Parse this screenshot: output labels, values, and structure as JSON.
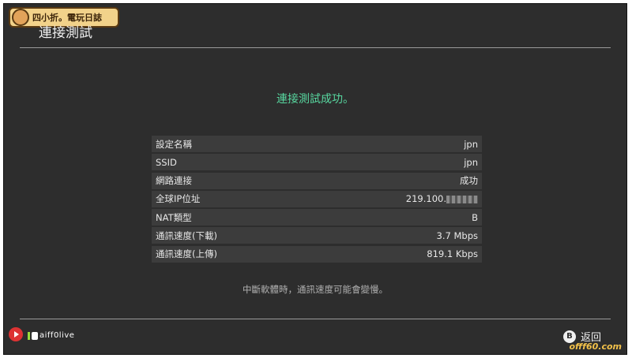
{
  "header": {
    "logo_text": "四小折。電玩日誌",
    "title": "連接測試"
  },
  "status_message": "連接測試成功。",
  "info_rows": [
    {
      "label": "設定名稱",
      "value": "jpn"
    },
    {
      "label": "SSID",
      "value": "jpn"
    },
    {
      "label": "網路連接",
      "value": "成功"
    },
    {
      "label": "全球IP位址",
      "value": "219.100."
    },
    {
      "label": "NAT類型",
      "value": "B"
    },
    {
      "label": "通訊速度(下載)",
      "value": "3.7 Mbps"
    },
    {
      "label": "通訊速度(上傳)",
      "value": "819.1 Kbps"
    }
  ],
  "note": "中斷軟體時，通訊速度可能會變慢。",
  "footer": {
    "back_button_glyph": "B",
    "back_label": "返回",
    "watermark_left": "aiff0live",
    "watermark_right": "offf60.com"
  },
  "colors": {
    "background": "#2d2d2d",
    "success_text": "#58d8a0",
    "row_background": "#3c3c3c"
  }
}
